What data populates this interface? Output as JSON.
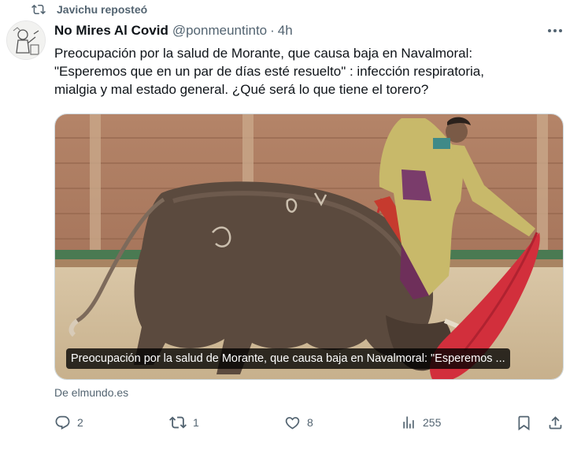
{
  "social_context": {
    "text": "Javichu reposteó",
    "icon": "repost-icon"
  },
  "author": {
    "name": "No Mires Al Covid",
    "handle": "@ponmeuntinto",
    "separator": "·",
    "time": "4h"
  },
  "post": {
    "lines": [
      "Preocupación por la salud de Morante, que causa baja en Navalmoral:",
      "\"Esperemos que en un par de días esté resuelto\" : infección respiratoria,",
      "mialgia y mal estado general. ¿Qué será lo que tiene el torero?"
    ]
  },
  "link_card": {
    "caption": "Preocupación por la salud de Morante, que causa baja en Navalmoral: \"Esperemos ...",
    "source": "De elmundo.es"
  },
  "actions": {
    "reply": {
      "icon": "reply-icon",
      "count": "2"
    },
    "repost": {
      "icon": "repost-icon",
      "count": "1"
    },
    "like": {
      "icon": "heart-icon",
      "count": "8"
    },
    "views": {
      "icon": "views-icon",
      "count": "255"
    },
    "bookmark": {
      "icon": "bookmark-icon"
    },
    "share": {
      "icon": "share-icon"
    }
  },
  "colors": {
    "text_primary": "#0f1419",
    "text_secondary": "#536471",
    "border": "#cfd9de"
  }
}
